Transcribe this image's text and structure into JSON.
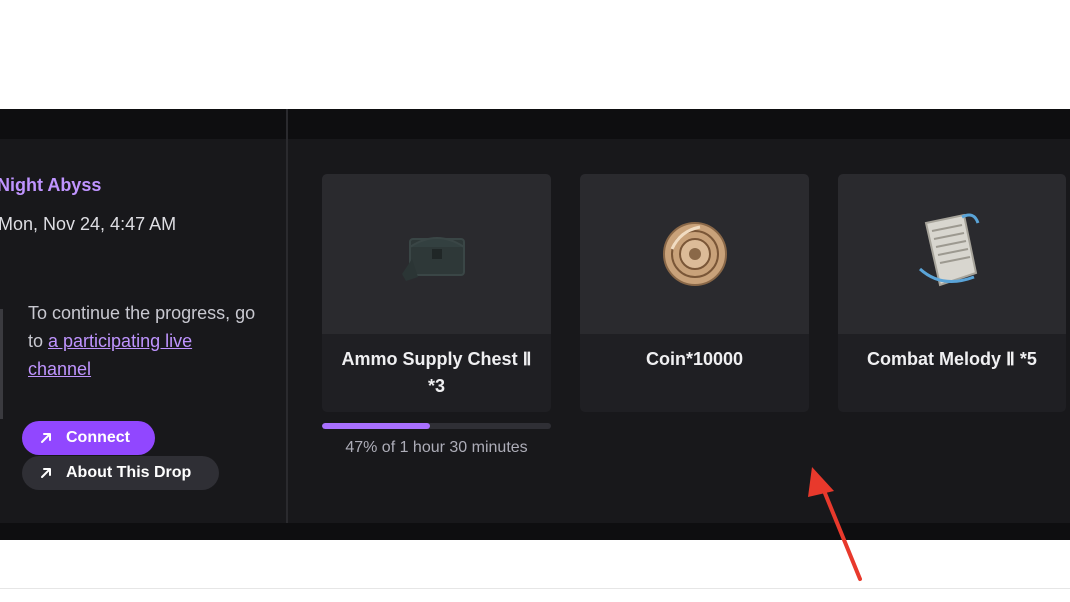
{
  "campaign": {
    "title": "Night Abyss",
    "date": "Mon, Nov 24, 4:47 AM"
  },
  "progress_message": {
    "text": "To continue the progress, go to ",
    "link_text": "a participating live channel"
  },
  "buttons": {
    "connect_label": "Connect",
    "about_label": "About This Drop"
  },
  "rewards": [
    {
      "name": "Ammo Supply Chest Ⅱ *3",
      "icon": "chest-icon"
    },
    {
      "name": "Coin*10000",
      "icon": "coin-icon"
    },
    {
      "name": "Combat Melody Ⅱ *5",
      "icon": "scroll-icon"
    }
  ],
  "progress": {
    "percent": 47,
    "text": "47% of 1 hour 30 minutes"
  },
  "colors": {
    "accent": "#9147ff",
    "link": "#bf94ff",
    "panel_bg": "#18181b",
    "annotation": "#e8392c"
  }
}
